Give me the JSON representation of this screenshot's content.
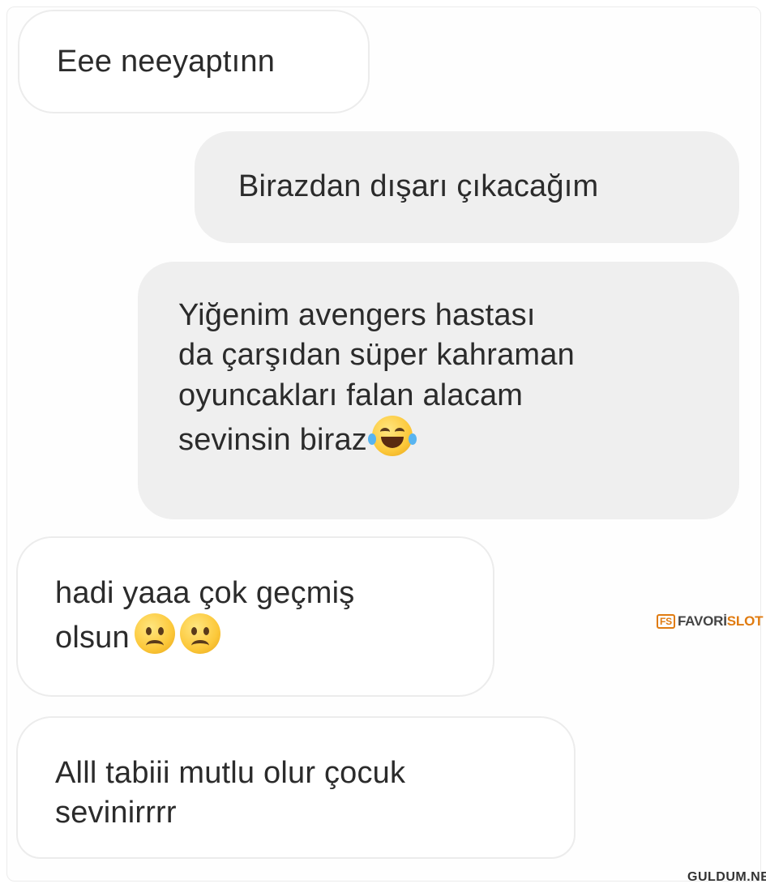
{
  "messages": [
    {
      "side": "incoming",
      "lines": [
        "Eee neeyaptınn"
      ]
    },
    {
      "side": "outgoing",
      "lines": [
        "Birazdan dışarı çıkacağım"
      ]
    },
    {
      "side": "outgoing",
      "lines": [
        "Yiğenim avengers hastası",
        "da çarşıdan süper kahraman",
        "oyuncakları falan alacam",
        "sevinsin biraz"
      ],
      "trailing_emoji": "face-with-tears-of-joy"
    },
    {
      "side": "incoming",
      "lines": [
        "hadi yaaa çok geçmiş",
        "olsun"
      ],
      "trailing_emoji": "slightly-frowning-face x2"
    },
    {
      "side": "incoming",
      "lines": [
        "Alll tabiii mutlu olur çocuk",
        "sevinirrrr"
      ]
    }
  ],
  "watermark": {
    "box": "FS",
    "part1": "FAVORİ",
    "part2": "SLOT"
  },
  "footer": {
    "logo": "GULDUM.NET"
  },
  "colors": {
    "incoming_bg": "#ffffff",
    "outgoing_bg": "#efefef",
    "text": "#2b2b2b",
    "watermark": "#e07b10"
  }
}
